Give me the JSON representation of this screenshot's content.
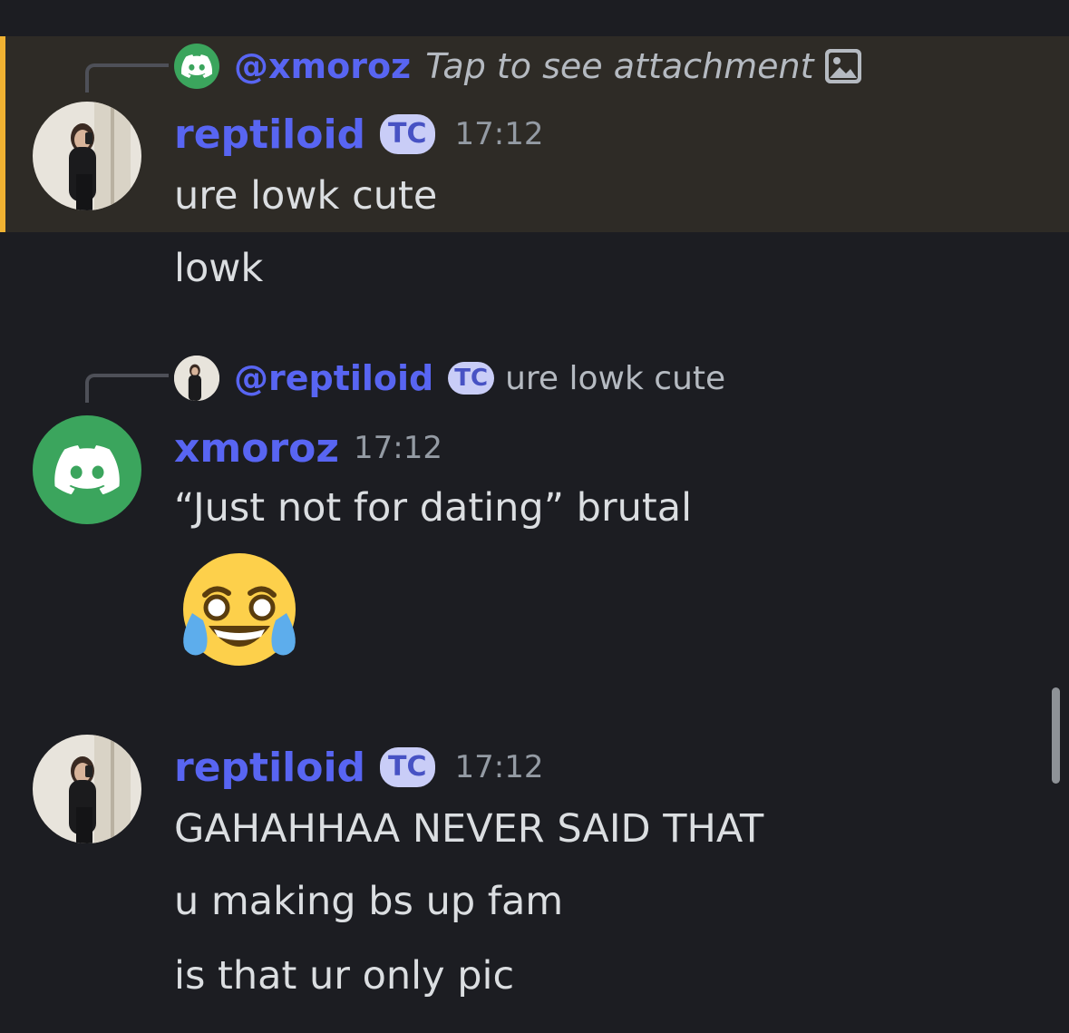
{
  "messages": [
    {
      "reply_to": {
        "name": "@xmoroz",
        "text": "Tap to see attachment",
        "has_attachment_icon": true
      },
      "author": "reptiloid",
      "tag": "TC",
      "time": "17:12",
      "highlighted": true,
      "lines": [
        "ure lowk cute",
        "lowk"
      ]
    },
    {
      "reply_to": {
        "name": "@reptiloid",
        "tag": "TC",
        "text": "ure lowk cute"
      },
      "author": "xmoroz",
      "time": "17:12",
      "lines": [
        "“Just not for dating” brutal"
      ],
      "emoji": "laughing-crying-emoji"
    },
    {
      "author": "reptiloid",
      "tag": "TC",
      "time": "17:12",
      "lines": [
        "GAHAHHAA NEVER SAID THAT",
        "u making bs up fam",
        "is that ur only pic"
      ]
    }
  ],
  "colors": {
    "background": "#1c1d22",
    "highlight": "#2e2b26",
    "mention_bar": "#f0b232",
    "username": "#5865f2",
    "discord_green": "#3ba55d"
  }
}
